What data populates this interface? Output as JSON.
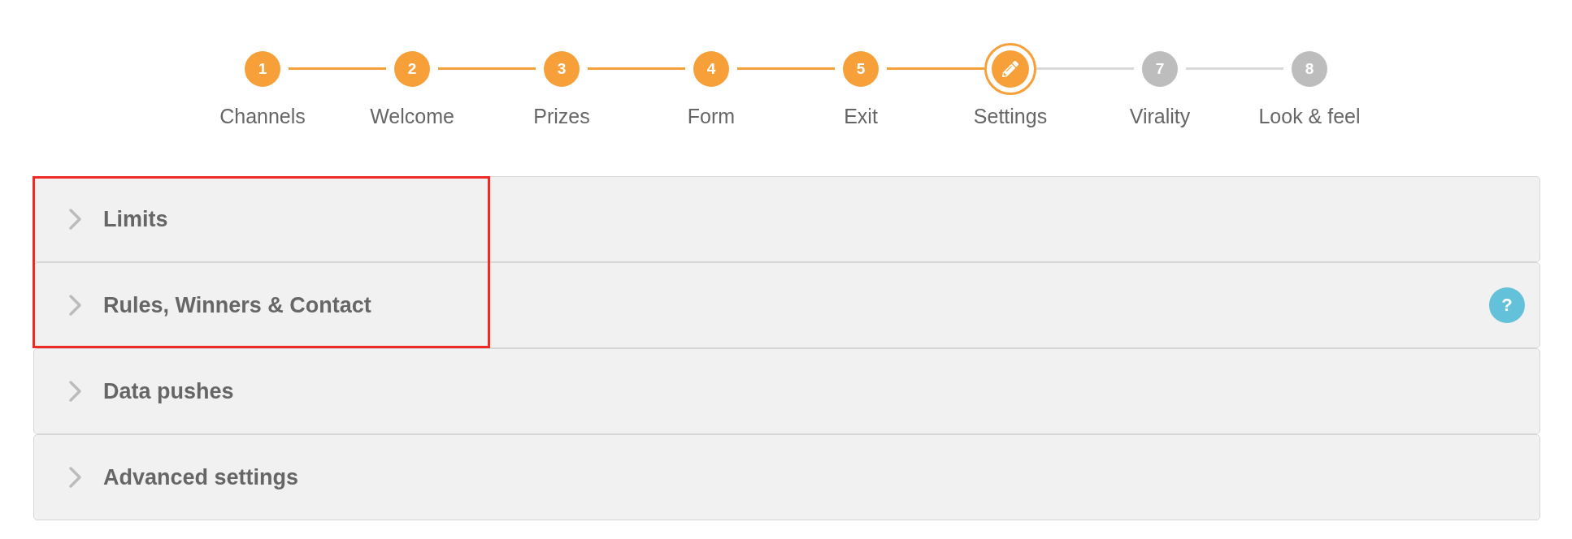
{
  "stepper": {
    "steps": [
      {
        "number": "1",
        "label": "Channels",
        "completed": true,
        "selected": false
      },
      {
        "number": "2",
        "label": "Welcome",
        "completed": true,
        "selected": false
      },
      {
        "number": "3",
        "label": "Prizes",
        "completed": true,
        "selected": false
      },
      {
        "number": "4",
        "label": "Form",
        "completed": true,
        "selected": false
      },
      {
        "number": "5",
        "label": "Exit",
        "completed": true,
        "selected": false
      },
      {
        "label": "Settings",
        "completed": false,
        "selected": true
      },
      {
        "number": "7",
        "label": "Virality",
        "completed": false,
        "selected": false
      },
      {
        "number": "8",
        "label": "Look & feel",
        "completed": false,
        "selected": false
      }
    ]
  },
  "panels": [
    {
      "title": "Limits",
      "expanded": false,
      "highlighted": true
    },
    {
      "title": "Rules, Winners & Contact",
      "expanded": false,
      "highlighted": true,
      "help": "?"
    },
    {
      "title": "Data pushes",
      "expanded": false,
      "highlighted": false
    },
    {
      "title": "Advanced settings",
      "expanded": false,
      "highlighted": false
    }
  ]
}
